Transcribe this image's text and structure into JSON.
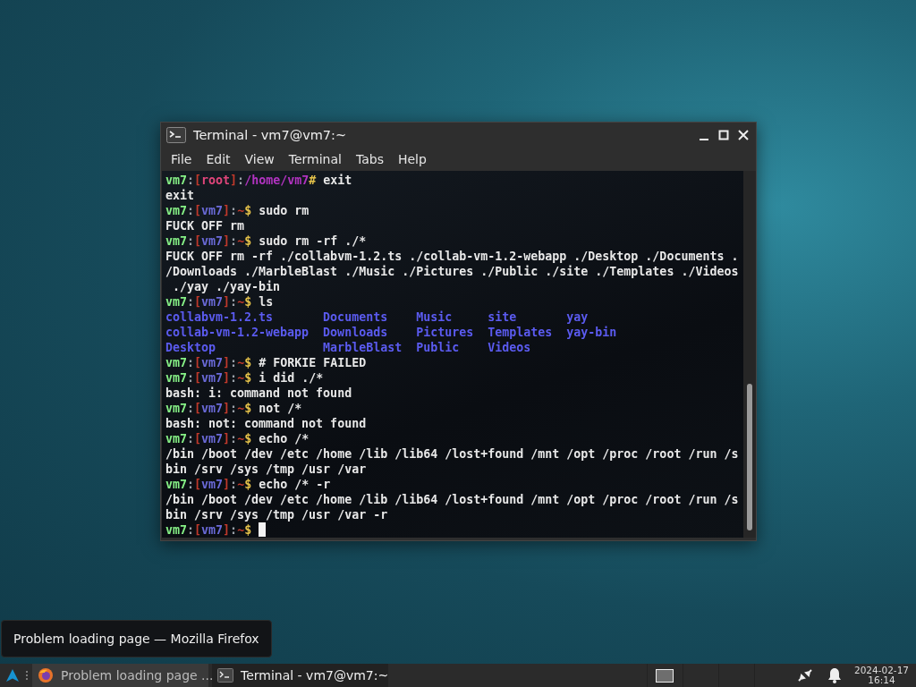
{
  "window": {
    "title": "Terminal - vm7@vm7:~",
    "menu": [
      "File",
      "Edit",
      "View",
      "Terminal",
      "Tabs",
      "Help"
    ]
  },
  "terminal": {
    "lines": [
      {
        "kind": "prompt",
        "root": true,
        "user": "vm7",
        "sep1": ":",
        "open": "[",
        "host": "root",
        "close": "]",
        "sep2": ":",
        "path": "/home/vm7",
        "sign": "#",
        "command": " exit"
      },
      {
        "kind": "output",
        "text": "exit"
      },
      {
        "kind": "prompt",
        "root": false,
        "user": "vm7",
        "sep1": ":",
        "open": "[",
        "host": "vm7",
        "close": "]",
        "sep2": ":",
        "path": "~",
        "sign": "$",
        "command": " sudo rm"
      },
      {
        "kind": "output",
        "text": "FUCK OFF rm"
      },
      {
        "kind": "prompt",
        "root": false,
        "user": "vm7",
        "sep1": ":",
        "open": "[",
        "host": "vm7",
        "close": "]",
        "sep2": ":",
        "path": "~",
        "sign": "$",
        "command": " sudo rm -rf ./*"
      },
      {
        "kind": "output",
        "text": "FUCK OFF rm -rf ./collabvm-1.2.ts ./collab-vm-1.2-webapp ./Desktop ./Documents ."
      },
      {
        "kind": "output",
        "text": "/Downloads ./MarbleBlast ./Music ./Pictures ./Public ./site ./Templates ./Videos"
      },
      {
        "kind": "output",
        "text": " ./yay ./yay-bin"
      },
      {
        "kind": "prompt",
        "root": false,
        "user": "vm7",
        "sep1": ":",
        "open": "[",
        "host": "vm7",
        "close": "]",
        "sep2": ":",
        "path": "~",
        "sign": "$",
        "command": " ls"
      },
      {
        "kind": "listing",
        "entries": [
          "collabvm-1.2.ts",
          "Documents",
          "Music",
          "site",
          "yay"
        ]
      },
      {
        "kind": "listing",
        "entries": [
          "collab-vm-1.2-webapp",
          "Downloads",
          "Pictures",
          "Templates",
          "yay-bin"
        ]
      },
      {
        "kind": "listing",
        "entries": [
          "Desktop",
          "MarbleBlast",
          "Public",
          "Videos"
        ]
      },
      {
        "kind": "prompt",
        "root": false,
        "user": "vm7",
        "sep1": ":",
        "open": "[",
        "host": "vm7",
        "close": "]",
        "sep2": ":",
        "path": "~",
        "sign": "$",
        "command": " # FORKIE FAILED"
      },
      {
        "kind": "prompt",
        "root": false,
        "user": "vm7",
        "sep1": ":",
        "open": "[",
        "host": "vm7",
        "close": "]",
        "sep2": ":",
        "path": "~",
        "sign": "$",
        "command": " i did ./*"
      },
      {
        "kind": "output",
        "text": "bash: i: command not found"
      },
      {
        "kind": "prompt",
        "root": false,
        "user": "vm7",
        "sep1": ":",
        "open": "[",
        "host": "vm7",
        "close": "]",
        "sep2": ":",
        "path": "~",
        "sign": "$",
        "command": " not /*"
      },
      {
        "kind": "output",
        "text": "bash: not: command not found"
      },
      {
        "kind": "prompt",
        "root": false,
        "user": "vm7",
        "sep1": ":",
        "open": "[",
        "host": "vm7",
        "close": "]",
        "sep2": ":",
        "path": "~",
        "sign": "$",
        "command": " echo /*"
      },
      {
        "kind": "output",
        "text": "/bin /boot /dev /etc /home /lib /lib64 /lost+found /mnt /opt /proc /root /run /s"
      },
      {
        "kind": "output",
        "text": "bin /srv /sys /tmp /usr /var"
      },
      {
        "kind": "prompt",
        "root": false,
        "user": "vm7",
        "sep1": ":",
        "open": "[",
        "host": "vm7",
        "close": "]",
        "sep2": ":",
        "path": "~",
        "sign": "$",
        "command": " echo /* -r"
      },
      {
        "kind": "output",
        "text": "/bin /boot /dev /etc /home /lib /lib64 /lost+found /mnt /opt /proc /root /run /s"
      },
      {
        "kind": "output",
        "text": "bin /srv /sys /tmp /usr /var -r"
      },
      {
        "kind": "prompt",
        "root": false,
        "user": "vm7",
        "sep1": ":",
        "open": "[",
        "host": "vm7",
        "close": "]",
        "sep2": ":",
        "path": "~",
        "sign": "$"
      }
    ]
  },
  "tooltip": {
    "text": "Problem loading page — Mozilla Firefox"
  },
  "taskbar": {
    "tasks": [
      {
        "kind": "browser",
        "label": "Problem loading page ...",
        "selected": false
      },
      {
        "kind": "terminal",
        "label": "Terminal - vm7@vm7:~",
        "selected": true
      }
    ],
    "workspaces": [
      {
        "selected": true
      },
      {
        "selected": false
      },
      {
        "selected": false
      },
      {
        "selected": false
      }
    ],
    "clock": {
      "date": "2024-02-17",
      "time": "16:14"
    }
  }
}
